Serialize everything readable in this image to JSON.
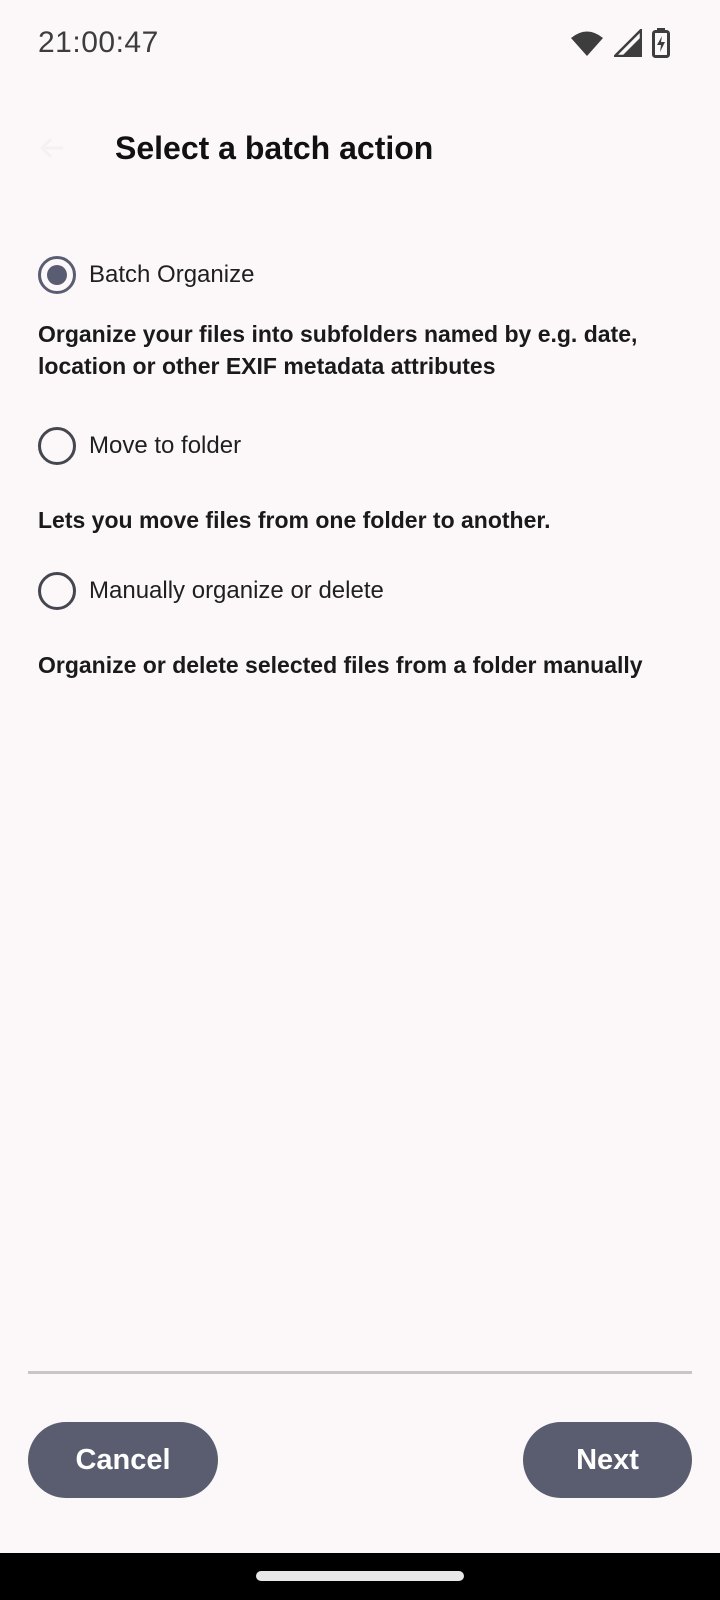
{
  "status_bar": {
    "time": "21:00:47",
    "icons": [
      "wifi-icon",
      "cell-signal-icon",
      "battery-charging-icon"
    ]
  },
  "app_bar": {
    "back_icon": "back-arrow-icon",
    "title": "Select a batch action"
  },
  "options": [
    {
      "label": "Batch Organize",
      "selected": true,
      "description": "Organize your files into subfolders named by e.g. date, location or other EXIF metadata attributes"
    },
    {
      "label": "Move to folder",
      "selected": false,
      "description": "Lets you move files from one folder to another."
    },
    {
      "label": "Manually organize or delete",
      "selected": false,
      "description": "Organize or delete selected files from a folder manually"
    }
  ],
  "actions": {
    "cancel_label": "Cancel",
    "next_label": "Next"
  },
  "colors": {
    "background": "#fcf8f9",
    "button": "#5a5d6f",
    "radio_selected": "#5a5d72"
  }
}
